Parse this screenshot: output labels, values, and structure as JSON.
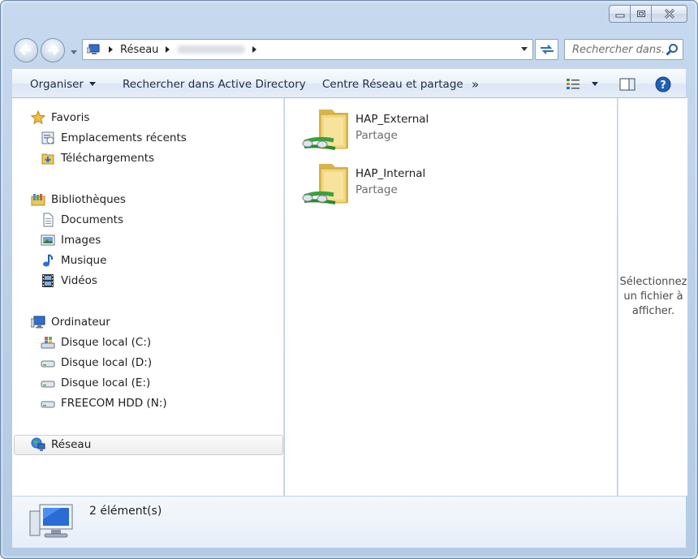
{
  "window": {
    "buttons": {
      "minimize": "minimize-icon",
      "maximize": "maximize-icon",
      "close": "close-icon"
    }
  },
  "address": {
    "breadcrumb": [
      "Réseau"
    ],
    "search_placeholder": "Rechercher dans..."
  },
  "toolbar": {
    "organize": "Organiser",
    "search_ad": "Rechercher dans Active Directory",
    "network_center": "Centre Réseau et partage",
    "more": "»"
  },
  "nav": {
    "favorites": {
      "label": "Favoris",
      "items": [
        {
          "label": "Emplacements récents"
        },
        {
          "label": "Téléchargements"
        }
      ]
    },
    "libraries": {
      "label": "Bibliothèques",
      "items": [
        {
          "label": "Documents"
        },
        {
          "label": "Images"
        },
        {
          "label": "Musique"
        },
        {
          "label": "Vidéos"
        }
      ]
    },
    "computer": {
      "label": "Ordinateur",
      "items": [
        {
          "label": "Disque local (C:)"
        },
        {
          "label": "Disque local (D:)"
        },
        {
          "label": "Disque local (E:)"
        },
        {
          "label": "FREECOM HDD (N:)"
        }
      ]
    },
    "network": {
      "label": "Réseau"
    }
  },
  "files": [
    {
      "name": "HAP_External",
      "type": "Partage"
    },
    {
      "name": "HAP_Internal",
      "type": "Partage"
    }
  ],
  "preview": {
    "text": "Sélectionnez un fichier à afficher."
  },
  "status": {
    "count": "2 élément(s)"
  },
  "colors": {
    "accent": "#1a5fb4",
    "folder": "#e9c85a",
    "selected_bg": "#ececec"
  }
}
